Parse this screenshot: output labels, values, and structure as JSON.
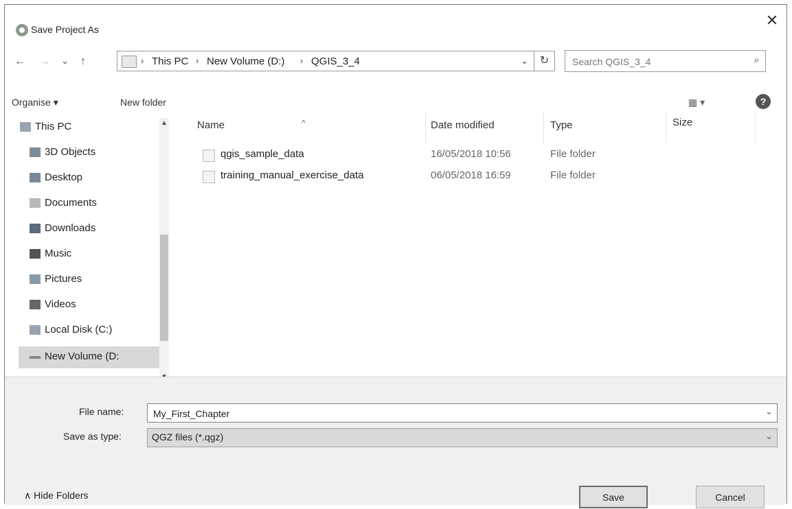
{
  "window": {
    "title": "Save Project As",
    "close_glyph": "✕"
  },
  "nav": {
    "back_glyph": "←",
    "forward_glyph": "→",
    "recent_glyph": "⌄",
    "up_glyph": "↑",
    "breadcrumbs": [
      "This PC",
      "New Volume (D:)",
      "QGIS_3_4"
    ],
    "crumb_sep": "›",
    "address_dropdown_glyph": "⌄",
    "refresh_glyph": "↻",
    "search_placeholder": "Search QGIS_3_4",
    "search_glyph": "⌕"
  },
  "toolbar": {
    "organise_label": "Organise ▾",
    "new_folder_label": "New folder",
    "view_glyph": "▦ ▾",
    "help_glyph": "?"
  },
  "sidebar": {
    "items": [
      {
        "label": "This PC",
        "icon": "computer-icon",
        "color": "#9aa4b0"
      },
      {
        "label": "3D Objects",
        "icon": "cube-icon",
        "color": "#7f8c99"
      },
      {
        "label": "Desktop",
        "icon": "desktop-icon",
        "color": "#7a8796"
      },
      {
        "label": "Documents",
        "icon": "document-icon",
        "color": "#b8b8b8"
      },
      {
        "label": "Downloads",
        "icon": "download-icon",
        "color": "#5b6b7b"
      },
      {
        "label": "Music",
        "icon": "music-icon",
        "color": "#555555"
      },
      {
        "label": "Pictures",
        "icon": "picture-icon",
        "color": "#8899a8"
      },
      {
        "label": "Videos",
        "icon": "video-icon",
        "color": "#666666"
      },
      {
        "label": "Local Disk (C:)",
        "icon": "disk-icon",
        "color": "#9aa4b0"
      },
      {
        "label": "New Volume (D:",
        "icon": "drive-icon",
        "color": "#888888",
        "selected": true
      }
    ]
  },
  "columns": {
    "name": "Name",
    "date_modified": "Date modified",
    "type": "Type",
    "size": "Size",
    "sort_glyph": "^"
  },
  "files": [
    {
      "name": "qgis_sample_data",
      "date": "16/05/2018 10:56",
      "type": "File folder",
      "size": ""
    },
    {
      "name": "training_manual_exercise_data",
      "date": "06/05/2018 16:59",
      "type": "File folder",
      "size": ""
    }
  ],
  "form": {
    "file_name_label": "File name:",
    "file_name_value": "My_First_Chapter",
    "save_type_label": "Save as type:",
    "save_type_value": "QGZ files (*.qgz)",
    "dropdown_glyph": "⌄"
  },
  "footer": {
    "hide_folders_label": "∧  Hide Folders",
    "save_label": "Save",
    "cancel_label": "Cancel"
  }
}
